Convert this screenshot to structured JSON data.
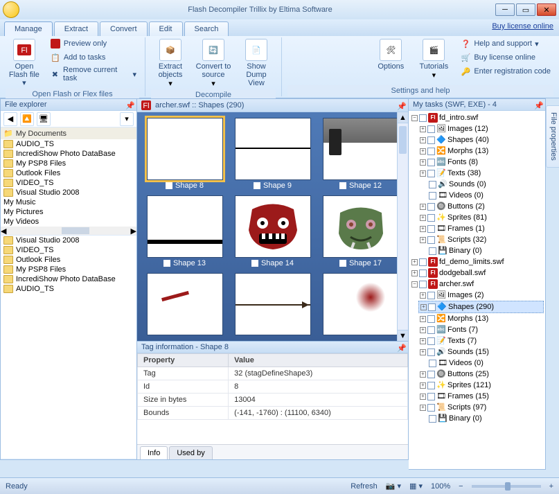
{
  "title": "Flash Decompiler Trillix by Eltima Software",
  "license_link": "Buy license online",
  "tabs": [
    "Manage",
    "Extract",
    "Convert",
    "Edit",
    "Search"
  ],
  "active_tab": 0,
  "ribbon": {
    "group1": {
      "label": "Open Flash or Flex files",
      "open_btn": "Open\nFlash file",
      "preview": "Preview only",
      "add": "Add to tasks",
      "remove": "Remove current task"
    },
    "group2": {
      "label": "Decompile",
      "extract": "Extract\nobjects",
      "convert": "Convert to\nsource",
      "dump": "Show\nDump View"
    },
    "group3": {
      "label": "Settings and help",
      "options": "Options",
      "tutorials": "Tutorials",
      "help": "Help and support",
      "buy": "Buy license online",
      "reg": "Enter registration code"
    }
  },
  "file_explorer": {
    "title": "File explorer",
    "top_root": "My Documents",
    "top_items": [
      "AUDIO_TS",
      "IncrediShow Photo DataBase",
      "My PSP8 Files",
      "Outlook Files",
      "VIDEO_TS",
      "Visual Studio 2008"
    ],
    "top_extra": [
      "My Music",
      "My Pictures",
      "My Videos"
    ],
    "bottom_items": [
      "Visual Studio 2008",
      "VIDEO_TS",
      "Outlook Files",
      "My PSP8 Files",
      "IncrediShow Photo DataBase",
      "AUDIO_TS"
    ]
  },
  "center": {
    "head": "archer.swf :: Shapes (290)",
    "shapes": [
      "Shape 8",
      "Shape 9",
      "Shape 12",
      "Shape 13",
      "Shape 14",
      "Shape 17",
      "",
      "",
      ""
    ],
    "selected": 0
  },
  "tag_info": {
    "title": "Tag information - Shape 8",
    "cols": [
      "Property",
      "Value"
    ],
    "rows": [
      [
        "Tag",
        "32 (stagDefineShape3)"
      ],
      [
        "Id",
        "8"
      ],
      [
        "Size in bytes",
        "13004"
      ],
      [
        "Bounds",
        "(-141, -1760) : (11100, 6340)"
      ]
    ],
    "tabs": [
      "Info",
      "Used by"
    ]
  },
  "tasks": {
    "title": "My tasks (SWF, EXE) - 4",
    "files": [
      {
        "name": "fd_intro.swf",
        "expanded": true,
        "children": [
          {
            "label": "Images (12)"
          },
          {
            "label": "Shapes (40)"
          },
          {
            "label": "Morphs (13)"
          },
          {
            "label": "Fonts (8)"
          },
          {
            "label": "Texts (38)"
          },
          {
            "label": "Sounds (0)",
            "leaf": true
          },
          {
            "label": "Videos (0)",
            "leaf": true
          },
          {
            "label": "Buttons (2)"
          },
          {
            "label": "Sprites (81)"
          },
          {
            "label": "Frames (1)"
          },
          {
            "label": "Scripts (32)"
          },
          {
            "label": "Binary (0)",
            "leaf": true
          }
        ]
      },
      {
        "name": "fd_demo_limits.swf",
        "expanded": false
      },
      {
        "name": "dodgeball.swf",
        "expanded": false
      },
      {
        "name": "archer.swf",
        "expanded": true,
        "children": [
          {
            "label": "Images (2)"
          },
          {
            "label": "Shapes (290)",
            "sel": true
          },
          {
            "label": "Morphs (13)"
          },
          {
            "label": "Fonts (7)"
          },
          {
            "label": "Texts (7)"
          },
          {
            "label": "Sounds (15)"
          },
          {
            "label": "Videos (0)",
            "leaf": true
          },
          {
            "label": "Buttons (25)"
          },
          {
            "label": "Sprites (121)"
          },
          {
            "label": "Frames (15)"
          },
          {
            "label": "Scripts (97)"
          },
          {
            "label": "Binary (0)",
            "leaf": true
          }
        ]
      }
    ]
  },
  "side_tab": "File properties",
  "status": {
    "ready": "Ready",
    "refresh": "Refresh",
    "zoom": "100%"
  }
}
